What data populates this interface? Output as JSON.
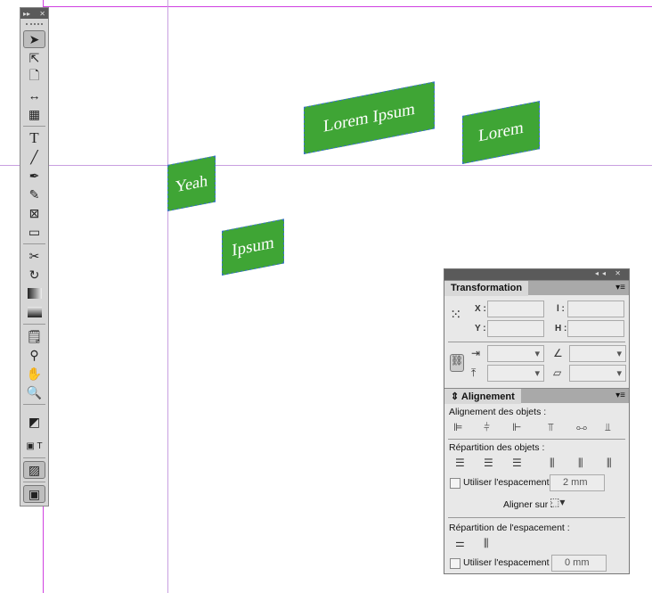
{
  "canvas": {
    "shapes": [
      {
        "label": "Yeah"
      },
      {
        "label": "Lorem Ipsum"
      },
      {
        "label": "Lorem"
      },
      {
        "label": "Ipsum"
      }
    ],
    "shape_color": "#3fa535"
  },
  "toolbox": {
    "header_left": "▸▸",
    "header_close": "✕"
  },
  "transformation": {
    "tab": "Transformation",
    "x_label": "X :",
    "y_label": "Y :",
    "w_label": "l :",
    "h_label": "H :"
  },
  "alignment": {
    "tab": "Alignement",
    "align_objects": "Alignement des objets :",
    "distribute_objects": "Répartition des objets :",
    "use_spacing": "Utiliser l'espacement",
    "spacing_value": "2 mm",
    "align_to": "Aligner sur :",
    "distribute_spacing": "Répartition de l'espacement :",
    "use_spacing2": "Utiliser l'espacement",
    "spacing_value2": "0 mm"
  }
}
